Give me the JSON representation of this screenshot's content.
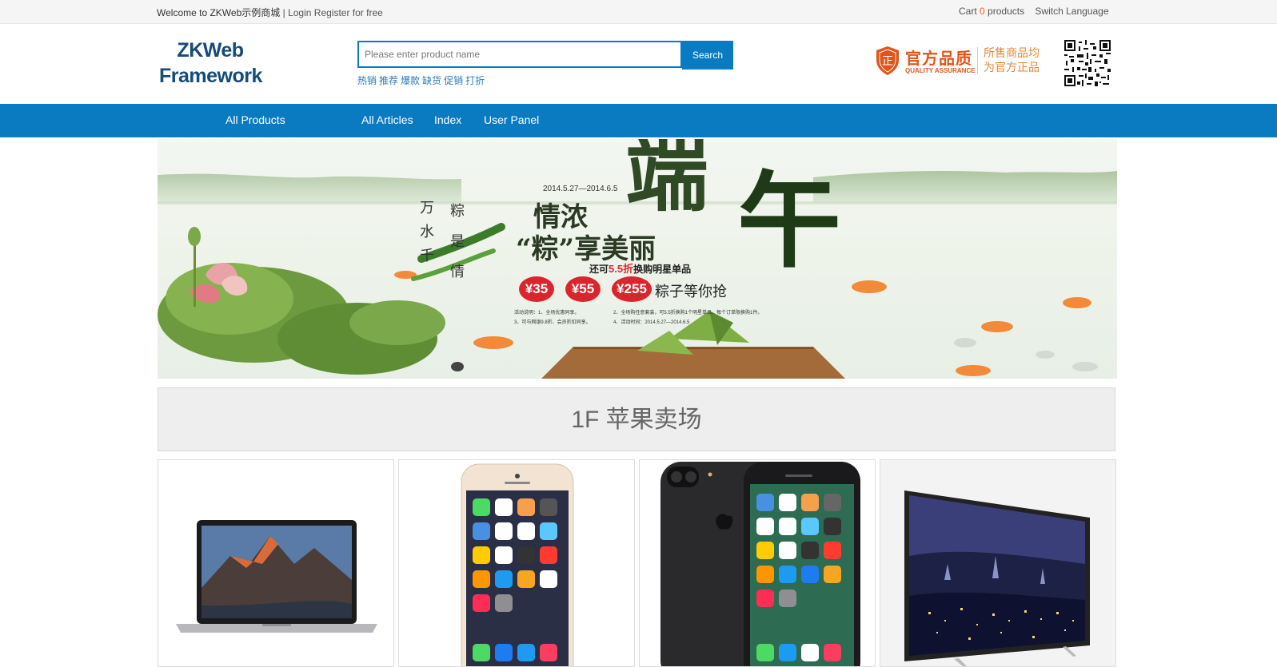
{
  "topbar": {
    "welcome": "Welcome to ZKWeb示例商城",
    "separator": " | ",
    "login": "Login",
    "register": "Register for free",
    "cart_label": "Cart",
    "cart_count": "0",
    "cart_suffix": "products",
    "switch_language": "Switch Language"
  },
  "header": {
    "logo_line1": "ZKWeb",
    "logo_line2": "Framework",
    "search_placeholder": "Please enter product name",
    "search_button": "Search",
    "hot_words": [
      "热销",
      "推荐",
      "爆款",
      "缺货",
      "促销",
      "打折"
    ],
    "quality_title": "官方品质",
    "quality_sub": "QUALITY ASSURANCE",
    "quality_desc_line1": "所售商品均",
    "quality_desc_line2": "为官方正品",
    "shield_char": "正"
  },
  "nav": {
    "items": [
      "All Products",
      "All Articles",
      "Index",
      "User Panel"
    ]
  },
  "banner": {
    "date": "2014.5.27—2014.6.5",
    "line1": "情浓",
    "big1": "端",
    "big2": "午",
    "line2": "“粽”享美丽",
    "promo_prefix": "还可",
    "promo_discount": "5.5折",
    "promo_suffix": "换购明星单品",
    "badges": [
      "¥35",
      "¥55",
      "¥255"
    ],
    "badges_tail": "粽子等你抢",
    "poem_col1": "万水千",
    "poem_col2": "粽是情",
    "rules_1": "活动说明：1、全场优惠同享。",
    "rules_2": "2、全场购任意套装，可5.5折换购1个明星单品，每个订单限换购1件。",
    "rules_3": "3、可与网银9.8折、会员折扣同享。",
    "rules_4": "4、活动时间：2014.5.27—2014.6.5"
  },
  "floor": {
    "title": "1F 苹果卖场"
  },
  "products": [
    {
      "name": "laptop"
    },
    {
      "name": "iphone-gold"
    },
    {
      "name": "iphone-black"
    },
    {
      "name": "television"
    }
  ],
  "colors": {
    "brand_blue": "#0a7bc1",
    "logo_blue": "#154a79",
    "accent_orange": "#e2541b"
  }
}
